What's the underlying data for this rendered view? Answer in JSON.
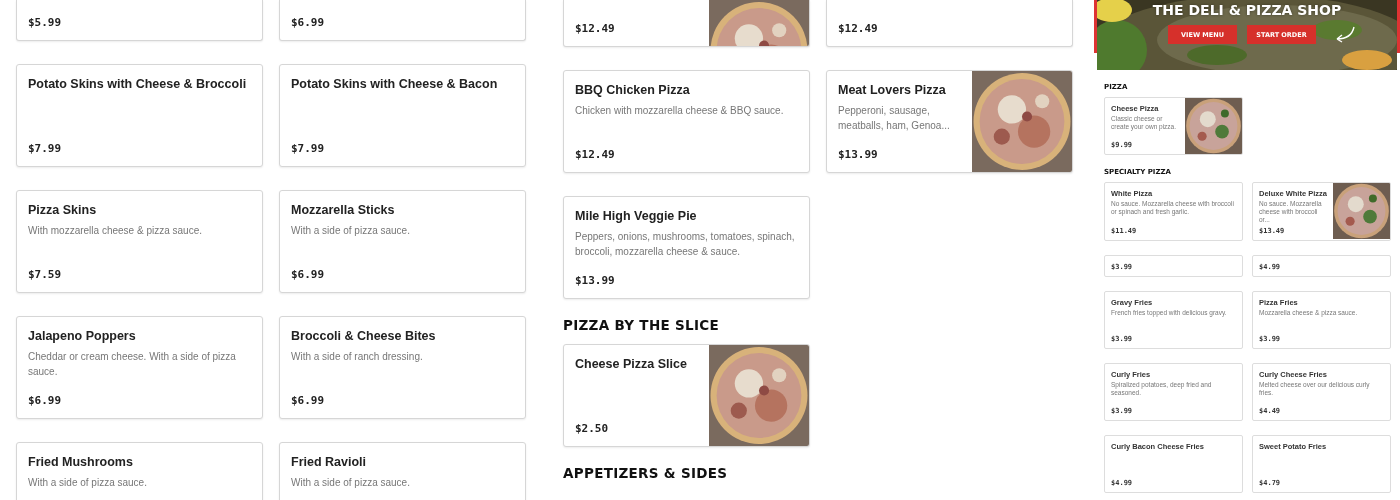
{
  "left_cards": [
    {
      "price": "$5.99"
    },
    {
      "price": "$6.99"
    },
    {
      "name": "Potato Skins with Cheese & Broccoli",
      "price": "$7.99"
    },
    {
      "name": "Potato Skins with Cheese & Bacon",
      "price": "$7.99"
    },
    {
      "name": "Pizza Skins",
      "description": "With mozzarella cheese & pizza sauce.",
      "price": "$7.59"
    },
    {
      "name": "Mozzarella Sticks",
      "description": "With a side of pizza sauce.",
      "price": "$6.99"
    },
    {
      "name": "Jalapeno Poppers",
      "description": "Cheddar or cream cheese. With a side of pizza sauce.",
      "price": "$6.99"
    },
    {
      "name": "Broccoli & Cheese Bites",
      "description": "With a side of ranch dressing.",
      "price": "$6.99"
    },
    {
      "name": "Fried Mushrooms",
      "description": "With a side of pizza sauce."
    },
    {
      "name": "Fried Ravioli",
      "description": "With a side of pizza sauce."
    }
  ],
  "middle_blocks": [
    {
      "kind": "cards",
      "cards": [
        {
          "price": "$12.49",
          "picture": true
        },
        {
          "price": "$12.49"
        },
        {
          "name": "BBQ Chicken Pizza",
          "description": "Chicken with mozzarella cheese & BBQ sauce.",
          "price": "$12.49"
        },
        {
          "name": "Meat Lovers Pizza",
          "description": "Pepperoni, sausage, meatballs, ham, Genoa...",
          "price": "$13.99",
          "picture": true
        },
        {
          "name": "Mile High Veggie Pie",
          "description": "Peppers, onions, mushrooms, tomatoes, spinach, broccoli, mozzarella cheese & sauce.",
          "price": "$13.99"
        }
      ]
    },
    {
      "kind": "heading",
      "text": "PIZZA BY THE SLICE"
    },
    {
      "kind": "cards",
      "cards": [
        {
          "name": "Cheese Pizza Slice",
          "price": "$2.50",
          "picture": true
        }
      ]
    },
    {
      "kind": "heading",
      "text": "APPETIZERS & SIDES"
    }
  ],
  "preview": {
    "title": "THE DELI & PIZZA SHOP",
    "buttons": [
      "VIEW MENU",
      "START ORDER"
    ],
    "blocks": [
      {
        "kind": "heading",
        "text": "PIZZA"
      },
      {
        "kind": "cards",
        "cards": [
          {
            "name": "Cheese Pizza",
            "description": "Classic cheese or create your own pizza.",
            "price": "$9.99",
            "picture": true
          }
        ]
      },
      {
        "kind": "heading",
        "text": "SPECIALTY PIZZA"
      },
      {
        "kind": "cards",
        "cards": [
          {
            "name": "White Pizza",
            "description": "No sauce. Mozzarella cheese with broccoli or spinach and fresh garlic.",
            "price": "$11.49"
          },
          {
            "name": "Deluxe White Pizza",
            "description": "No sauce. Mozzarella cheese with broccoli or...",
            "price": "$13.49",
            "picture": true
          },
          {
            "price": "$3.99"
          },
          {
            "price": "$4.99"
          },
          {
            "name": "Gravy Fries",
            "description": "French fries topped with delicious gravy.",
            "price": "$3.99"
          },
          {
            "name": "Pizza Fries",
            "description": "Mozzarella cheese & pizza sauce.",
            "price": "$3.99"
          },
          {
            "name": "Curly Fries",
            "description": "Spiralized potatoes, deep fried and seasoned.",
            "price": "$3.99"
          },
          {
            "name": "Curly Cheese Fries",
            "description": "Melted cheese over our delicious curly fries.",
            "price": "$4.49"
          },
          {
            "name": "Curly Bacon Cheese Fries",
            "price": "$4.99"
          },
          {
            "name": "Sweet Potato Fries",
            "price": "$4.79"
          }
        ]
      }
    ]
  }
}
